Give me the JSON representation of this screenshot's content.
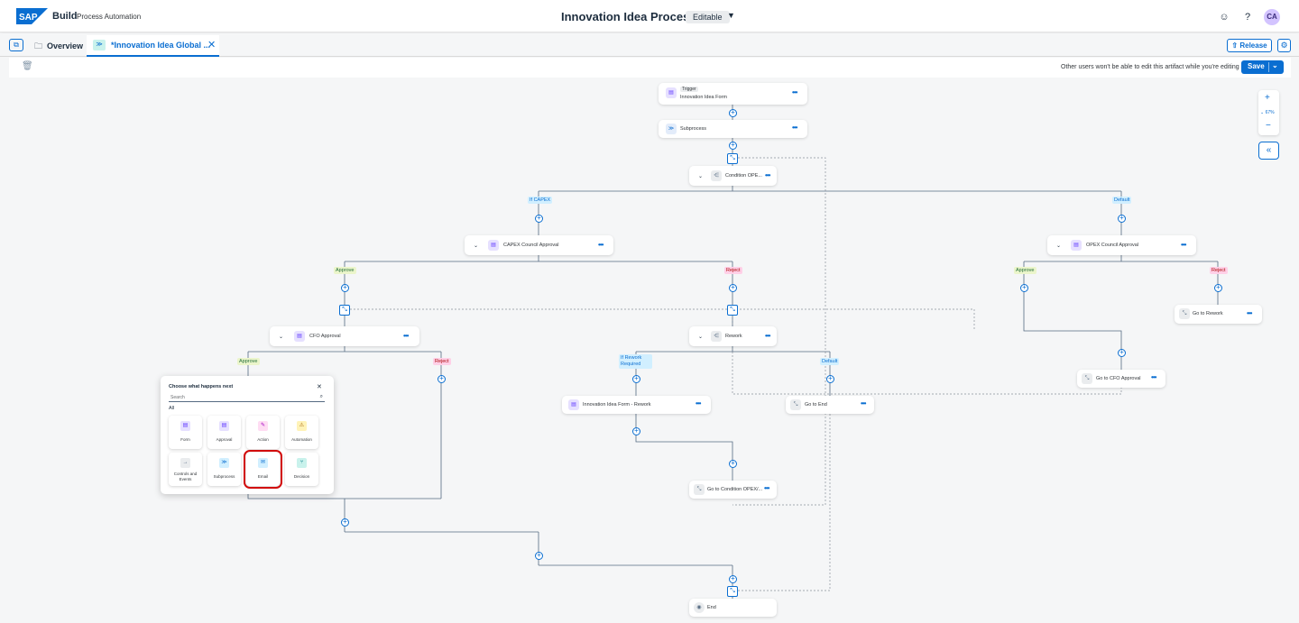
{
  "shell": {
    "brand": "Build",
    "brand_sub": "Process Automation",
    "title": "Innovation Idea Process",
    "status": "Editable",
    "avatar": "CA"
  },
  "tabs": {
    "overview": "Overview",
    "active": "*Innovation Idea Global ...",
    "release": "Release"
  },
  "toolbar": {
    "note": "Other users won't be able to edit this artifact while you're editing it.",
    "save": "Save"
  },
  "zoom": {
    "level": "67%"
  },
  "nodes": {
    "trigger_tag": "Trigger",
    "trigger": "Innovation Idea Form",
    "subprocess": "Subprocess",
    "condition": "Condition OPE...",
    "capex_approval": "CAPEX Council Approval",
    "opex_approval": "OPEX Council Approval",
    "cfo_approval": "CFO Approval",
    "rework": "Rework",
    "rework_form": "Innovation Idea Form - Rework",
    "go_to_end": "Go to End",
    "go_to_rework": "Go to Rework",
    "go_to_cfo": "Go to CFO Approval",
    "go_to_condition": "Go to Condition OPEX/...",
    "end": "End"
  },
  "branch_labels": {
    "if_capex": "If CAPEX",
    "default1": "Default",
    "approve1": "Approve",
    "reject1": "Reject",
    "approve2": "Approve",
    "reject2": "Reject",
    "approve3": "Approve",
    "reject3": "Reject",
    "if_rework": "If Rework Required",
    "default2": "Default"
  },
  "chooser": {
    "title": "Choose what happens next",
    "search_placeholder": "Search",
    "category": "All",
    "tiles": [
      "Form",
      "Approval",
      "Action",
      "Automation",
      "Controls and Events",
      "Subprocess",
      "Email",
      "Decision"
    ]
  }
}
